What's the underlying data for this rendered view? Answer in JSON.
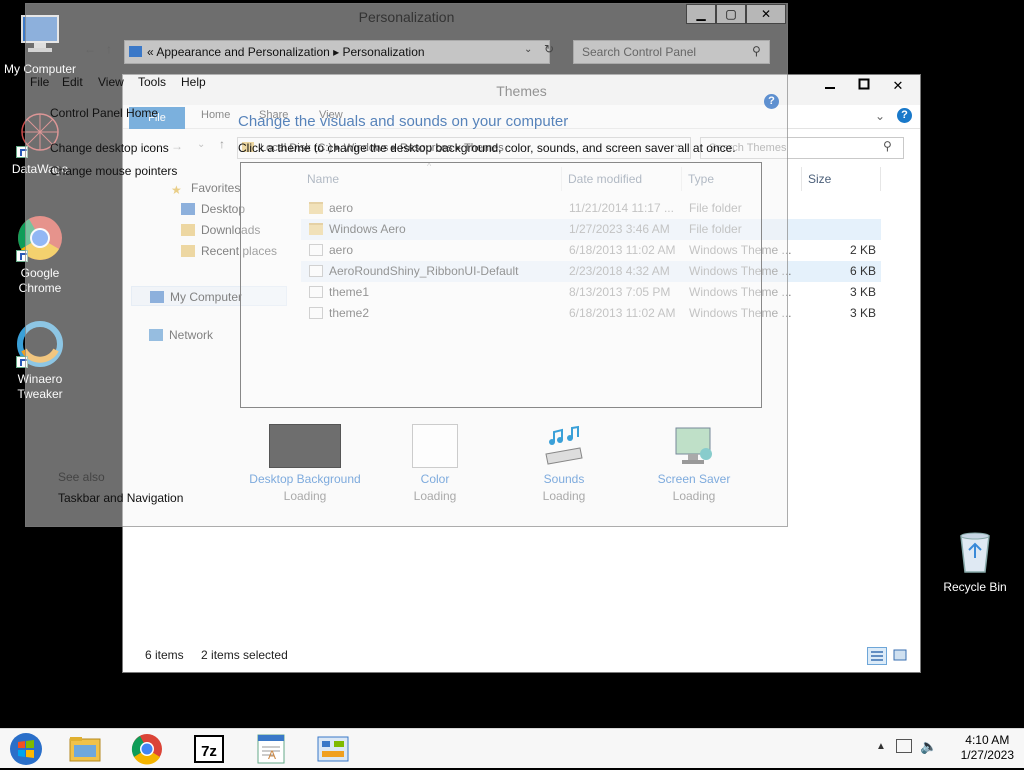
{
  "desktop": {
    "icons": [
      {
        "label": "My Computer"
      },
      {
        "label": "DataWago"
      },
      {
        "label": "Google Chrome"
      },
      {
        "label": "Winaero Tweaker"
      },
      {
        "label": "Recycle Bin"
      }
    ]
  },
  "explorer": {
    "title": "Themes",
    "ribbon_tabs": [
      "File",
      "Home",
      "Share",
      "View"
    ],
    "address_path": "Local Disk (C:) ▸ Windows ▸ Resources ▸ Themes",
    "search_placeholder": "Search Themes",
    "nav": {
      "favorites": "Favorites",
      "desktop": "Desktop",
      "downloads": "Downloads",
      "recent": "Recent places",
      "computer": "My Computer",
      "network": "Network"
    },
    "columns": [
      "Name",
      "Date modified",
      "Type",
      "Size"
    ],
    "files": [
      {
        "name": "aero",
        "date": "11/21/2014 11:17 ...",
        "type": "File folder",
        "size": "",
        "kind": "folder",
        "selected": false
      },
      {
        "name": "Windows Aero",
        "date": "1/27/2023 3:46 AM",
        "type": "File folder",
        "size": "",
        "kind": "folder",
        "selected": true
      },
      {
        "name": "aero",
        "date": "6/18/2013 11:02 AM",
        "type": "Windows Theme ...",
        "size": "2 KB",
        "kind": "theme",
        "selected": false
      },
      {
        "name": "AeroRoundShiny_RibbonUI-Default",
        "date": "2/23/2018 4:32 AM",
        "type": "Windows Theme ...",
        "size": "6 KB",
        "kind": "theme",
        "selected": true
      },
      {
        "name": "theme1",
        "date": "8/13/2013 7:05 PM",
        "type": "Windows Theme ...",
        "size": "3 KB",
        "kind": "theme",
        "selected": false
      },
      {
        "name": "theme2",
        "date": "6/18/2013 11:02 AM",
        "type": "Windows Theme ...",
        "size": "3 KB",
        "kind": "theme",
        "selected": false
      }
    ],
    "status_count": "6 items",
    "status_selected": "2 items selected"
  },
  "personalization": {
    "title": "Personalization",
    "address": "« Appearance and Personalization ▸ Personalization",
    "search_placeholder": "Search Control Panel",
    "menu": [
      "File",
      "Edit",
      "View",
      "Tools",
      "Help"
    ],
    "home_link": "Control Panel Home",
    "links": [
      "Change desktop icons",
      "Change mouse pointers"
    ],
    "headline": "Change the visuals and sounds on your computer",
    "subtext": "Click a theme to change the desktop background, color, sounds, and screen saver all at once.",
    "see_also": "See also",
    "see_also_link": "Taskbar and Navigation",
    "tiles": [
      {
        "label": "Desktop Background",
        "status": "Loading"
      },
      {
        "label": "Color",
        "status": "Loading"
      },
      {
        "label": "Sounds",
        "status": "Loading"
      },
      {
        "label": "Screen Saver",
        "status": "Loading"
      }
    ]
  },
  "taskbar": {
    "time": "4:10 AM",
    "date": "1/27/2023"
  }
}
